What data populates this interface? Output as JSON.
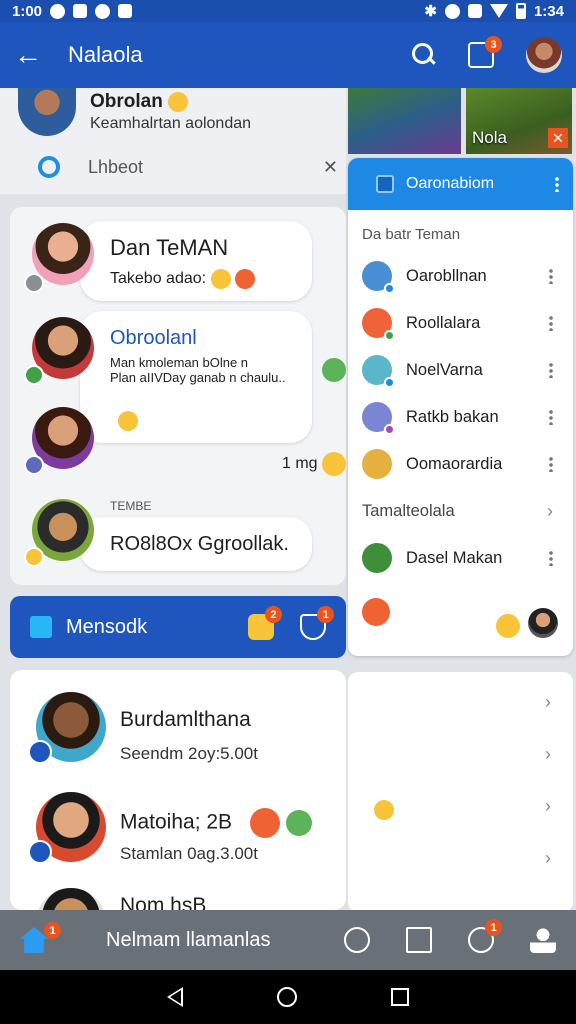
{
  "status_bar": {
    "time_left": "1:00",
    "time_right": "1:34"
  },
  "app_bar": {
    "title": "Nalaola",
    "notification_count": "3"
  },
  "profile": {
    "name": "Obrolan",
    "subtitle": "Keamhalrtan aolondan"
  },
  "search": {
    "placeholder": "Lhbeot"
  },
  "chats": [
    {
      "title": "Dan TeMAN",
      "text": "Takebo adao:"
    },
    {
      "title": "Obroolanl",
      "text": "Man  kmoleman bOlne n\nPlan aIIVDay  ganab n chaulu.."
    },
    {
      "time": "1 mg"
    },
    {
      "header": "TEMBE",
      "text": "RO8l8Ox  Ggroollak."
    }
  ],
  "menu_bar": {
    "label": "Mensodk",
    "badge_1": "2",
    "badge_2": "1"
  },
  "list": [
    {
      "name": "Burdamlthana",
      "status": "Seendm 2oy:5.00t"
    },
    {
      "name": "Matoiha;  2B",
      "status": "Stamlan 0ag.3.00t"
    },
    {
      "name": "Nom hsB"
    }
  ],
  "thumb_label": "Nola",
  "panel": {
    "title": "Oaronabiom",
    "section_1": "Da batr Teman",
    "contacts": [
      {
        "name": "Oarobllnan",
        "color": "#4a8ed4"
      },
      {
        "name": "Roollalara",
        "color": "#f0623a"
      },
      {
        "name": "NoelVarna",
        "color": "#5ab7c9"
      },
      {
        "name": "Ratkb bakan",
        "color": "#7a85d6"
      },
      {
        "name": "Oomaorardia",
        "color": "#e4b040"
      }
    ],
    "section_2": "Tamalteolala",
    "contact_extra": {
      "name": "Dasel Makan",
      "color": "#3e8e3a"
    }
  },
  "bottom_nav": {
    "label": "Nelmam llamanlas",
    "home_badge": "1",
    "chat_badge": "1"
  }
}
